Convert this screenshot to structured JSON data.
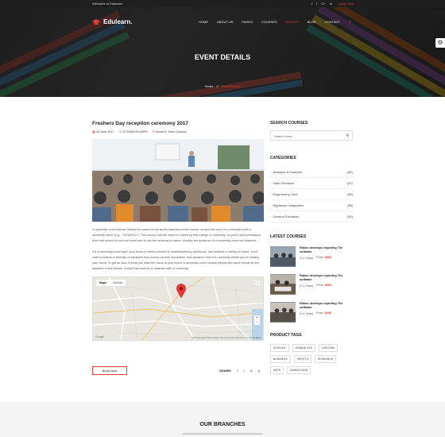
{
  "topbar": {
    "welcome": "Welcome to Edulearn",
    "socials": [
      "f",
      "t",
      "G+",
      "in"
    ],
    "apply": "Apply Now"
  },
  "header": {
    "brand": "Edulearn.",
    "nav": [
      "HOME",
      "ABOUT US",
      "PAGES",
      "COURSES",
      "EVENTS",
      "BLOG",
      "CONTACT"
    ],
    "active_nav": "EVENTS"
  },
  "hero": {
    "title": "EVENT DETAILS",
    "breadcrumb_home": "Home",
    "breadcrumb_sep": "//",
    "breadcrumb_current": "Event Details"
  },
  "event": {
    "title": "Freshers Day reception ceremony 2017",
    "date": "28 June 2017",
    "time": "12:30AM-05:30PM",
    "venue": "Venue A, Main Campus",
    "para1": "A university event license follows the same format as the standard event license, except this event is co-branded with a university name (e.g., \"TEDxNYU\"). This means that the event is hosted by that college or university, so you'll need permission from that school to hold the event and to use the university's name. Usually, the audience of a university event are students.",
    "para2": "For a university event type, your focus or theme should be multidisciplinary and broad, and address a variety of topics. You'll want to feature a diversity of speakers from across several disciplines, and speakers from the university where you're holding your event. To get an idea of what you want the focus of your event. A university event license follows the same format as the standard event license, except this event is co-branded with a university.",
    "book_label": "Book Now",
    "share_label": "SHARE:",
    "share_icons": [
      "f",
      "t",
      "G",
      "p"
    ]
  },
  "map": {
    "tab_map": "Maps",
    "tab_satellite": "Satellite",
    "footer": "Datos del mapa ©2017 Google   Términos de uso   Informar de un error de Maps",
    "google": "Google",
    "colors": {
      "land": "#e7e6e0",
      "road": "#ffffff",
      "pin": "#e53935"
    }
  },
  "sidebar": {
    "search_title": "SEARCH COURSES",
    "search_placeholder": "Search Here ...",
    "categories_title": "CATEGORIES",
    "categories": [
      {
        "name": "Analytics & Features",
        "count": "(55)"
      },
      {
        "name": "Video Reviews",
        "count": "(57)"
      },
      {
        "name": "Engineering Tech",
        "count": "(98)"
      },
      {
        "name": "Righteous Indignation",
        "count": "(98)"
      },
      {
        "name": "General Education",
        "count": "(54)"
      }
    ],
    "latest_title": "LATEST COURSES",
    "courses": [
      {
        "title": "Raken develops reporting The software",
        "years": "4 Years",
        "price_label": "Price:",
        "price": "$350"
      },
      {
        "title": "Raken develops reporting The software",
        "years": "4 Years",
        "price_label": "Price:",
        "price": "$550"
      },
      {
        "title": "Raken develops reporting The software",
        "years": "4 Years",
        "price_label": "Price:",
        "price": "$350"
      }
    ],
    "tags_title": "PRODUCT TAGS",
    "tags": [
      "SCIENCE",
      "HUMANITIES",
      "DIPLOMA",
      "BUSINESS",
      "SPROTS",
      "RESEARCH",
      "ARTS",
      "ADMISSIONS"
    ]
  },
  "footer": {
    "branches_title": "OUR BRANCHES"
  },
  "colors": {
    "accent": "#e53935",
    "dark": "#1e1e1e",
    "text": "#555555"
  }
}
